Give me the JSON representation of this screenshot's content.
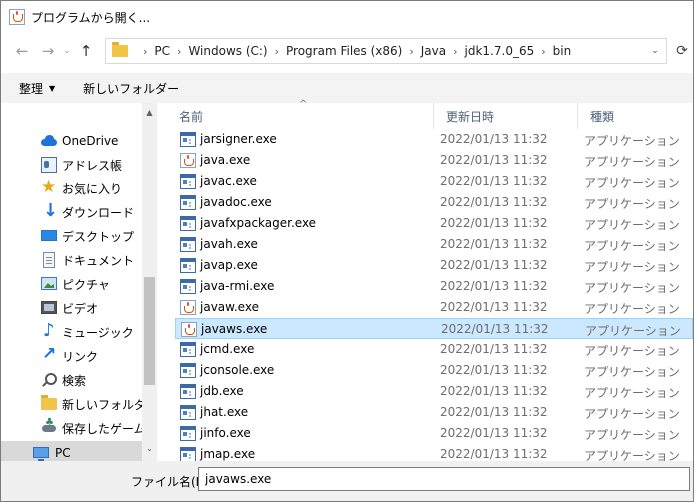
{
  "window": {
    "title": "プログラムから開く..."
  },
  "address": {
    "crumbs": [
      "PC",
      "Windows (C:)",
      "Program Files (x86)",
      "Java",
      "jdk1.7.0_65",
      "bin"
    ]
  },
  "toolbar": {
    "organize_label": "整理",
    "new_folder_label": "新しいフォルダー"
  },
  "sidebar": {
    "items": [
      {
        "label": "OneDrive",
        "icon": "onedrive-icon"
      },
      {
        "label": "アドレス帳",
        "icon": "address-book-icon"
      },
      {
        "label": "お気に入り",
        "icon": "favorites-star-icon"
      },
      {
        "label": "ダウンロード",
        "icon": "download-arrow-icon"
      },
      {
        "label": "デスクトップ",
        "icon": "desktop-icon"
      },
      {
        "label": "ドキュメント",
        "icon": "document-icon"
      },
      {
        "label": "ピクチャ",
        "icon": "pictures-icon"
      },
      {
        "label": "ビデオ",
        "icon": "video-icon"
      },
      {
        "label": "ミュージック",
        "icon": "music-note-icon"
      },
      {
        "label": "リンク",
        "icon": "link-arrow-icon"
      },
      {
        "label": "検索",
        "icon": "search-magnifier-icon"
      },
      {
        "label": "新しいフォルダー",
        "icon": "folder-icon"
      },
      {
        "label": "保存したゲーム",
        "icon": "saved-games-icon"
      },
      {
        "label": "PC",
        "icon": "pc-monitor-icon"
      }
    ]
  },
  "list": {
    "headers": {
      "name": "名前",
      "modified": "更新日時",
      "type": "種類"
    },
    "files": [
      {
        "name": "jarsigner.exe",
        "date": "2022/01/13 11:32",
        "type": "アプリケーション",
        "icon": "exe"
      },
      {
        "name": "java.exe",
        "date": "2022/01/13 11:32",
        "type": "アプリケーション",
        "icon": "java"
      },
      {
        "name": "javac.exe",
        "date": "2022/01/13 11:32",
        "type": "アプリケーション",
        "icon": "exe"
      },
      {
        "name": "javadoc.exe",
        "date": "2022/01/13 11:32",
        "type": "アプリケーション",
        "icon": "exe"
      },
      {
        "name": "javafxpackager.exe",
        "date": "2022/01/13 11:32",
        "type": "アプリケーション",
        "icon": "exe"
      },
      {
        "name": "javah.exe",
        "date": "2022/01/13 11:32",
        "type": "アプリケーション",
        "icon": "exe"
      },
      {
        "name": "javap.exe",
        "date": "2022/01/13 11:32",
        "type": "アプリケーション",
        "icon": "exe"
      },
      {
        "name": "java-rmi.exe",
        "date": "2022/01/13 11:32",
        "type": "アプリケーション",
        "icon": "exe"
      },
      {
        "name": "javaw.exe",
        "date": "2022/01/13 11:32",
        "type": "アプリケーション",
        "icon": "java"
      },
      {
        "name": "javaws.exe",
        "date": "2022/01/13 11:32",
        "type": "アプリケーション",
        "icon": "java"
      },
      {
        "name": "jcmd.exe",
        "date": "2022/01/13 11:32",
        "type": "アプリケーション",
        "icon": "exe"
      },
      {
        "name": "jconsole.exe",
        "date": "2022/01/13 11:32",
        "type": "アプリケーション",
        "icon": "exe"
      },
      {
        "name": "jdb.exe",
        "date": "2022/01/13 11:32",
        "type": "アプリケーション",
        "icon": "exe"
      },
      {
        "name": "jhat.exe",
        "date": "2022/01/13 11:32",
        "type": "アプリケーション",
        "icon": "exe"
      },
      {
        "name": "jinfo.exe",
        "date": "2022/01/13 11:32",
        "type": "アプリケーション",
        "icon": "exe"
      },
      {
        "name": "jmap.exe",
        "date": "2022/01/13 11:32",
        "type": "アプリケーション",
        "icon": "exe"
      }
    ]
  },
  "filename": {
    "label": "ファイル名(N):",
    "value": "javaws.exe"
  },
  "colors": {
    "selection_bg": "#cce8ff",
    "selection_border": "#99d1ff",
    "toolbar_bg": "#f3f3f3",
    "bottom_bg": "#f0f0f0"
  }
}
